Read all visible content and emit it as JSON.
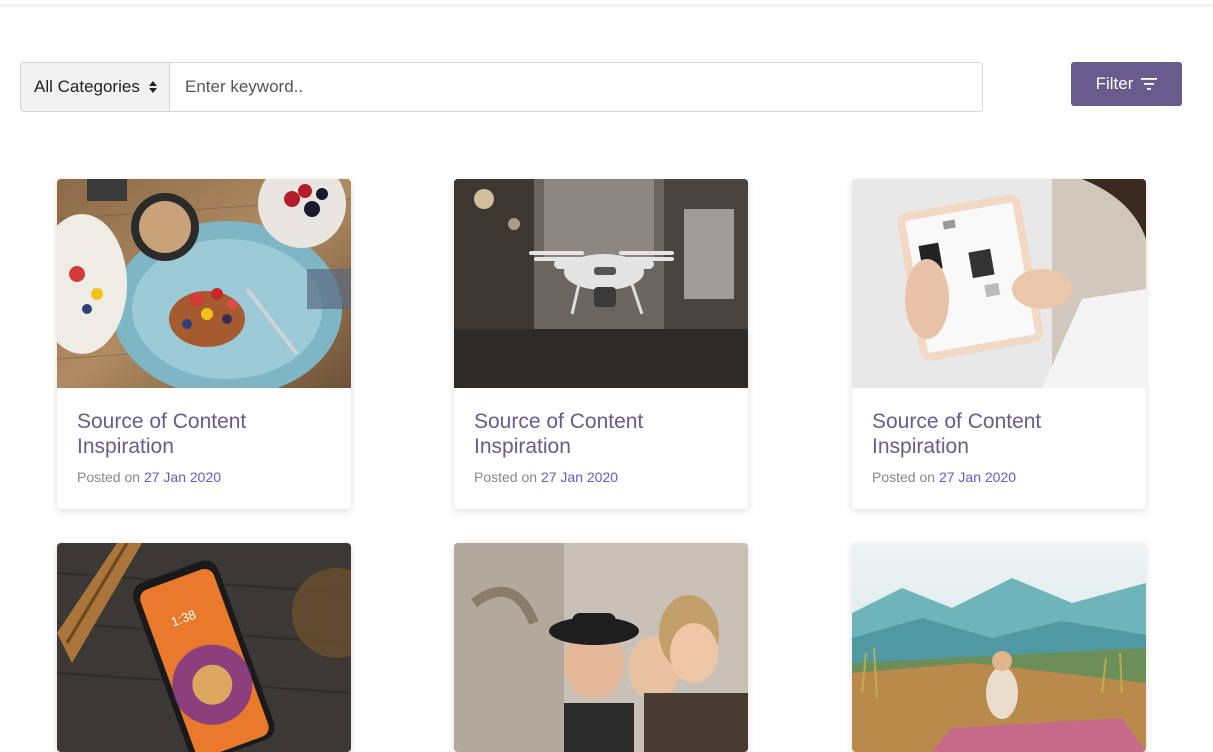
{
  "search": {
    "category_selected": "All Categories",
    "keyword_placeholder": "Enter keyword..",
    "keyword_value": "",
    "filter_label": "Filter"
  },
  "posts": [
    {
      "title": "Source of Content Inspiration",
      "posted_prefix": "Posted on",
      "date": "27 Jan 2020",
      "image": "breakfast-plate-photo"
    },
    {
      "title": "Source of Content Inspiration",
      "posted_prefix": "Posted on",
      "date": "27 Jan 2020",
      "image": "drone-photo"
    },
    {
      "title": "Source of Content Inspiration",
      "posted_prefix": "Posted on",
      "date": "27 Jan 2020",
      "image": "tablet-hands-photo"
    },
    {
      "image": "smartphone-photo"
    },
    {
      "image": "friends-laughing-photo"
    },
    {
      "image": "mountain-picnic-photo"
    }
  ],
  "colors": {
    "accent": "#675c8c",
    "date_link": "#6b54d6",
    "meta_text": "#888888"
  }
}
